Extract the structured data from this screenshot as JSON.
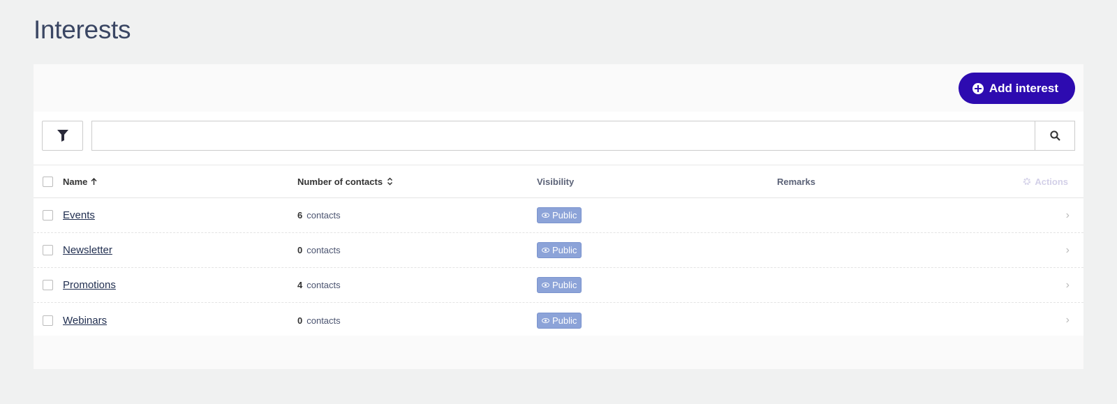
{
  "page": {
    "title": "Interests"
  },
  "toolbar": {
    "add_label": "Add interest"
  },
  "search": {
    "placeholder": "",
    "value": ""
  },
  "table": {
    "headers": {
      "name": "Name",
      "contacts": "Number of contacts",
      "visibility": "Visibility",
      "remarks": "Remarks",
      "actions": "Actions"
    },
    "rows": [
      {
        "name": "Events",
        "count": "6",
        "count_unit": "contacts",
        "visibility": "Public",
        "remarks": ""
      },
      {
        "name": "Newsletter",
        "count": "0",
        "count_unit": "contacts",
        "visibility": "Public",
        "remarks": ""
      },
      {
        "name": "Promotions",
        "count": "4",
        "count_unit": "contacts",
        "visibility": "Public",
        "remarks": ""
      },
      {
        "name": "Webinars",
        "count": "0",
        "count_unit": "contacts",
        "visibility": "Public",
        "remarks": ""
      }
    ]
  },
  "colors": {
    "accent": "#2d0bb0",
    "badge": "#8ca3d8",
    "title": "#3a4663"
  },
  "icons": {
    "add": "plus-circle-icon",
    "filter": "filter-icon",
    "search": "search-icon",
    "sort_asc": "arrow-up-icon",
    "sort_both": "sort-icon",
    "actions": "gear-icon",
    "visibility": "eye-icon",
    "row_open": "chevron-right-icon"
  }
}
